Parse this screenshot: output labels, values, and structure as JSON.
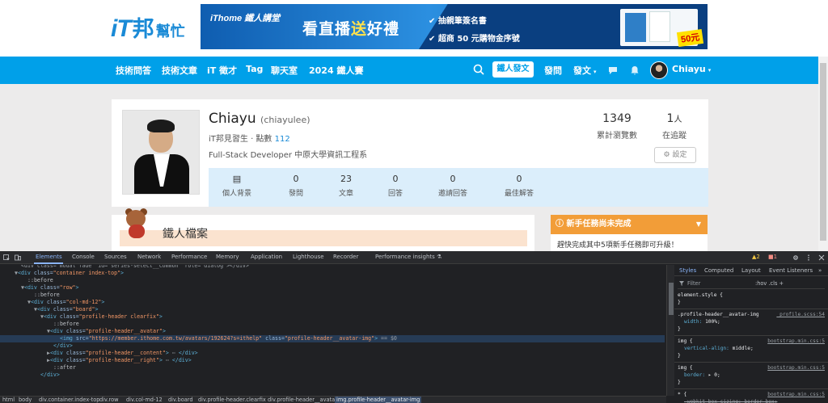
{
  "brand": {
    "logo_it": "iT",
    "logo_bang": "邦",
    "logo_help": "幫忙"
  },
  "banner": {
    "brand": "iThome 鐵人講堂",
    "main_a": "看直播",
    "main_b": "送",
    "main_c": "好禮",
    "line1": "✔ 抽親筆簽名書",
    "line2": "✔ 超商 50 元購物金序號",
    "price": "50元"
  },
  "nav": {
    "items": [
      "技術問答",
      "技術文章",
      "iT 徵才",
      "Tag",
      "聊天室",
      "2024 鐵人賽"
    ],
    "post_button": "鐵人發文",
    "ask": "發問",
    "write": "發文",
    "user": "Chiayu",
    "icons": [
      "search-icon",
      "chat-icon",
      "bell-icon"
    ]
  },
  "profile": {
    "name": "Chiayu",
    "handle": "(chiayulee)",
    "rank": "iT邦見習生 · 點數",
    "points": "112",
    "description": "Full-Stack Developer 中原大學資訊工程系",
    "views": "1349",
    "views_label": "累計瀏覽數",
    "followers": "1",
    "followers_unit": "人",
    "followers_label": "在追蹤",
    "settings": "⚙ 設定",
    "stats": [
      {
        "n": "▤",
        "l": "個人背景"
      },
      {
        "n": "0",
        "l": "發問"
      },
      {
        "n": "23",
        "l": "文章"
      },
      {
        "n": "0",
        "l": "回答"
      },
      {
        "n": "0",
        "l": "邀請回答"
      },
      {
        "n": "0",
        "l": "最佳解答"
      }
    ]
  },
  "ironman": {
    "title": "鐵人檔案"
  },
  "task": {
    "title": "ⓘ 新手任務尚未完成",
    "caret": "▼",
    "body": "趕快完成其中5項新手任務即可升級！"
  },
  "devtools": {
    "tabs": [
      "Elements",
      "Console",
      "Sources",
      "Network",
      "Performance",
      "Memory",
      "Application",
      "Lighthouse",
      "Recorder",
      "Performance insights ⚗"
    ],
    "warnings": "▲2",
    "errors": "■1",
    "dom_lines": [
      {
        "indent": 3,
        "parts": [
          [
            "dim",
            "<div class=\"modal fade\" id=\"series-select__common\" role=\"dialog\"></div>"
          ]
        ]
      },
      {
        "indent": 2,
        "parts": [
          [
            "dim",
            "▼"
          ],
          [
            "tag",
            "<div "
          ],
          [
            "attr",
            "class="
          ],
          [
            "val",
            "\"container index-top\""
          ],
          [
            "tag",
            ">"
          ]
        ]
      },
      {
        "indent": 4,
        "parts": [
          [
            "pseudo",
            "::before"
          ]
        ]
      },
      {
        "indent": 3,
        "parts": [
          [
            "dim",
            "▼"
          ],
          [
            "tag",
            "<div "
          ],
          [
            "attr",
            "class="
          ],
          [
            "val",
            "\"row\""
          ],
          [
            "tag",
            ">"
          ]
        ]
      },
      {
        "indent": 5,
        "parts": [
          [
            "pseudo",
            "::before"
          ]
        ]
      },
      {
        "indent": 4,
        "parts": [
          [
            "dim",
            "▼"
          ],
          [
            "tag",
            "<div "
          ],
          [
            "attr",
            "class="
          ],
          [
            "val",
            "\"col-md-12\""
          ],
          [
            "tag",
            ">"
          ]
        ]
      },
      {
        "indent": 5,
        "parts": [
          [
            "dim",
            "▼"
          ],
          [
            "tag",
            "<div "
          ],
          [
            "attr",
            "class="
          ],
          [
            "val",
            "\"board\""
          ],
          [
            "tag",
            ">"
          ]
        ]
      },
      {
        "indent": 6,
        "parts": [
          [
            "dim",
            "▼"
          ],
          [
            "tag",
            "<div "
          ],
          [
            "attr",
            "class="
          ],
          [
            "val",
            "\"profile-header clearfix\""
          ],
          [
            "tag",
            ">"
          ]
        ]
      },
      {
        "indent": 8,
        "parts": [
          [
            "pseudo",
            "::before"
          ]
        ]
      },
      {
        "indent": 7,
        "parts": [
          [
            "dim",
            "▼"
          ],
          [
            "tag",
            "<div "
          ],
          [
            "attr",
            "class="
          ],
          [
            "val",
            "\"profile-header__avatar\""
          ],
          [
            "tag",
            ">"
          ]
        ]
      },
      {
        "indent": 9,
        "selected": true,
        "parts": [
          [
            "tag",
            "<img "
          ],
          [
            "attr",
            "src="
          ],
          [
            "val",
            "\"https://member.ithome.com.tw/avatars/192624?s=ithelp\""
          ],
          [
            "attr",
            " class="
          ],
          [
            "val",
            "\"profile-header__avatar-img\""
          ],
          [
            "tag",
            ">"
          ],
          [
            "dim",
            " == $0"
          ]
        ]
      },
      {
        "indent": 8,
        "parts": [
          [
            "tag",
            "</div>"
          ]
        ]
      },
      {
        "indent": 7,
        "parts": [
          [
            "dim",
            "▶"
          ],
          [
            "tag",
            "<div "
          ],
          [
            "attr",
            "class="
          ],
          [
            "val",
            "\"profile-header__content\""
          ],
          [
            "tag",
            ">"
          ],
          [
            "dim",
            " ⋯ "
          ],
          [
            "tag",
            "</div>"
          ]
        ]
      },
      {
        "indent": 7,
        "parts": [
          [
            "dim",
            "▶"
          ],
          [
            "tag",
            "<div "
          ],
          [
            "attr",
            "class="
          ],
          [
            "val",
            "\"profile-header__right\""
          ],
          [
            "tag",
            ">"
          ],
          [
            "dim",
            " ⋯ "
          ],
          [
            "tag",
            "</div>"
          ]
        ]
      },
      {
        "indent": 8,
        "parts": [
          [
            "pseudo",
            "::after"
          ]
        ]
      },
      {
        "indent": 6,
        "parts": [
          [
            "tag",
            "</div>"
          ]
        ]
      }
    ],
    "style_tabs": [
      "Styles",
      "Computed",
      "Layout",
      "Event Listeners",
      "»"
    ],
    "filter_placeholder": "Filter",
    "filter_tools": ":hov  .cls  +",
    "rules": [
      {
        "selector": "element.style {",
        "src": "",
        "props": [],
        "close": "}"
      },
      {
        "selector": ".profile-header__avatar-img",
        "src": "_profile.scss:54",
        "props": [
          [
            "width",
            "100%;",
            false
          ]
        ],
        "close": "}"
      },
      {
        "selector": "img {",
        "src": "bootstrap.min.css:5",
        "props": [
          [
            "vertical-align",
            "middle;",
            false
          ]
        ],
        "close": "}"
      },
      {
        "selector": "img {",
        "src": "bootstrap.min.css:5",
        "props": [
          [
            "border",
            "▸ 0;",
            false
          ]
        ],
        "close": "}"
      },
      {
        "selector": "* {",
        "src": "bootstrap.min.css:5",
        "props": [
          [
            "-webkit-box-sizing",
            "border-box;",
            true
          ]
        ],
        "close": ""
      }
    ],
    "breadcrumbs": [
      "html",
      "body",
      "div.container.index-top",
      "div.row",
      "div.col-md-12",
      "div.board",
      "div.profile-header.clearfix",
      "div.profile-header__avatar",
      "img.profile-header__avatar-img"
    ]
  }
}
